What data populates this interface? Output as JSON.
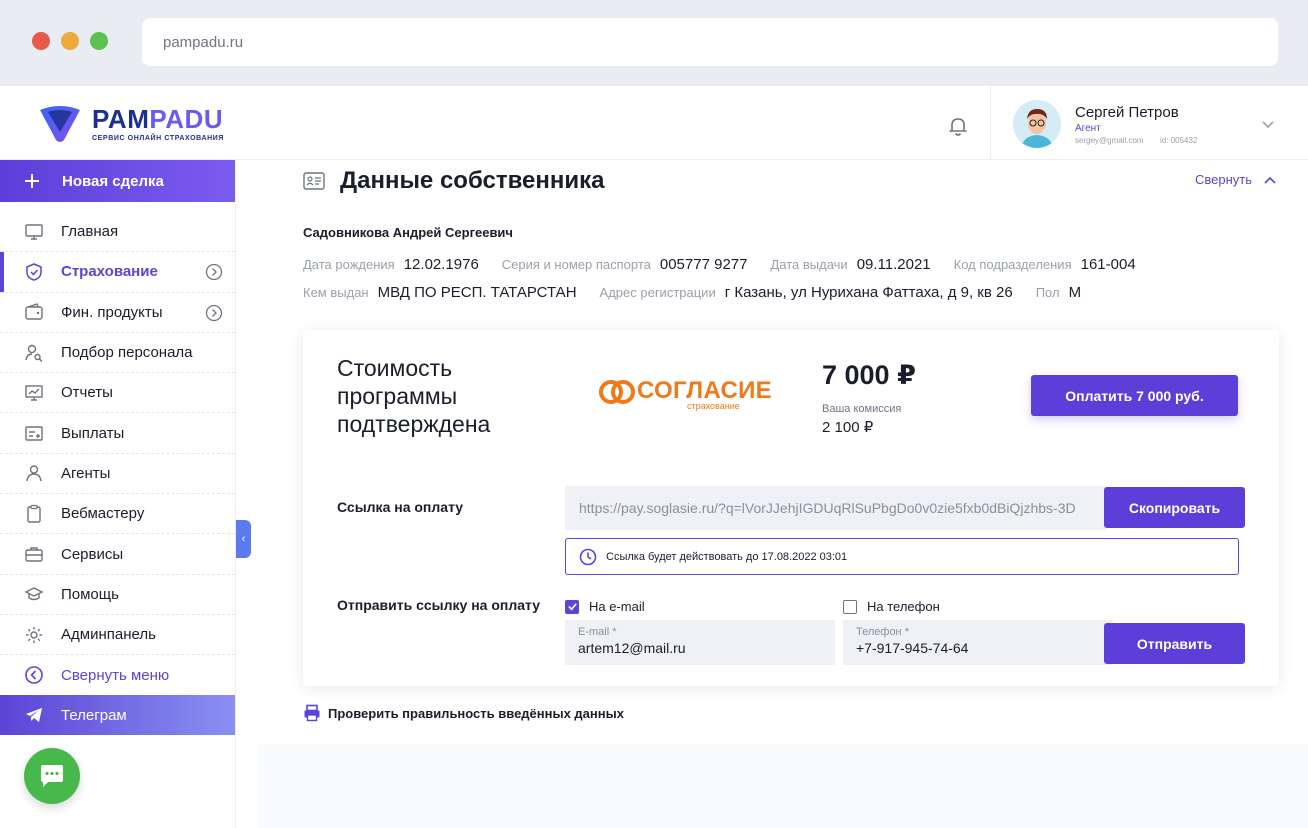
{
  "browser": {
    "url": "pampadu.ru"
  },
  "header": {
    "logo_name_1": "PAM",
    "logo_name_2": "PADU",
    "logo_sub": "СЕРВИС ОНЛАЙН СТРАХОВАНИЯ",
    "user": {
      "name": "Сергей Петров",
      "role": "Агент",
      "email": "sergey@gmail.com",
      "id": "id: 005432"
    }
  },
  "sidebar": {
    "new_deal": "Новая сделка",
    "items": [
      {
        "label": "Главная",
        "icon": "monitor-icon"
      },
      {
        "label": "Страхование",
        "icon": "shield-icon"
      },
      {
        "label": "Фин. продукты",
        "icon": "wallet-icon"
      },
      {
        "label": "Подбор персонала",
        "icon": "person-search-icon"
      },
      {
        "label": "Отчеты",
        "icon": "chart-board-icon"
      },
      {
        "label": "Выплаты",
        "icon": "payout-icon"
      },
      {
        "label": "Агенты",
        "icon": "user-icon"
      },
      {
        "label": "Вебмастеру",
        "icon": "clipboard-icon"
      },
      {
        "label": "Сервисы",
        "icon": "briefcase-icon"
      },
      {
        "label": "Помощь",
        "icon": "help-icon"
      },
      {
        "label": "Админпанель",
        "icon": "gear-icon"
      }
    ],
    "collapse": "Свернуть меню",
    "telegram": "Телеграм",
    "active_color": "#5b44d6"
  },
  "owner": {
    "section_title": "Данные собственника",
    "collapse": "Свернуть",
    "full_name": "Садовникова Андрей Сергеевич",
    "birth_label": "Дата рождения",
    "birth": "12.02.1976",
    "passport_label": "Серия и номер паспорта",
    "passport": "005777 9277",
    "issue_date_label": "Дата выдачи",
    "issue_date": "09.11.2021",
    "division_label": "Код подразделения",
    "division": "161-004",
    "issued_by_label": "Кем выдан",
    "issued_by": "МВД ПО РЕСП. ТАТАРСТАН",
    "address_label": "Адрес регистрации",
    "address": "г Казань, ул Нурихана Фаттаха, д 9, кв 26",
    "sex_label": "Пол",
    "sex": "М"
  },
  "payment": {
    "title": "Стоимость программы подтверждена",
    "insurer_name": "СОГЛАСИЕ",
    "insurer_sub": "страхование",
    "insurer_color": "#f07a1a",
    "price": "7 000 ₽",
    "commission_label": "Ваша комиссия",
    "commission": "2 100 ₽",
    "pay_button": "Оплатить 7 000 руб.",
    "link_label": "Ссылка на оплату",
    "link": "https://pay.soglasie.ru/?q=lVorJJehjIGDUqRlSuPbgDo0v0zie5fxb0dBiQjzhbs-3D",
    "copy_button": "Скопировать",
    "validity": "Ссылка будет действовать до 17.08.2022 03:01",
    "send_label": "Отправить ссылку на оплату",
    "email_check": "На e-mail",
    "email_checked": true,
    "phone_check": "На телефон",
    "phone_checked": false,
    "email_field_label": "E-mail *",
    "email_value": "artem12@mail.ru",
    "phone_field_label": "Телефон *",
    "phone_value": "+7-917-945-74-64",
    "send_button": "Отправить",
    "accent": "#5b3fd8"
  },
  "verify": "Проверить правильность введённых данных"
}
